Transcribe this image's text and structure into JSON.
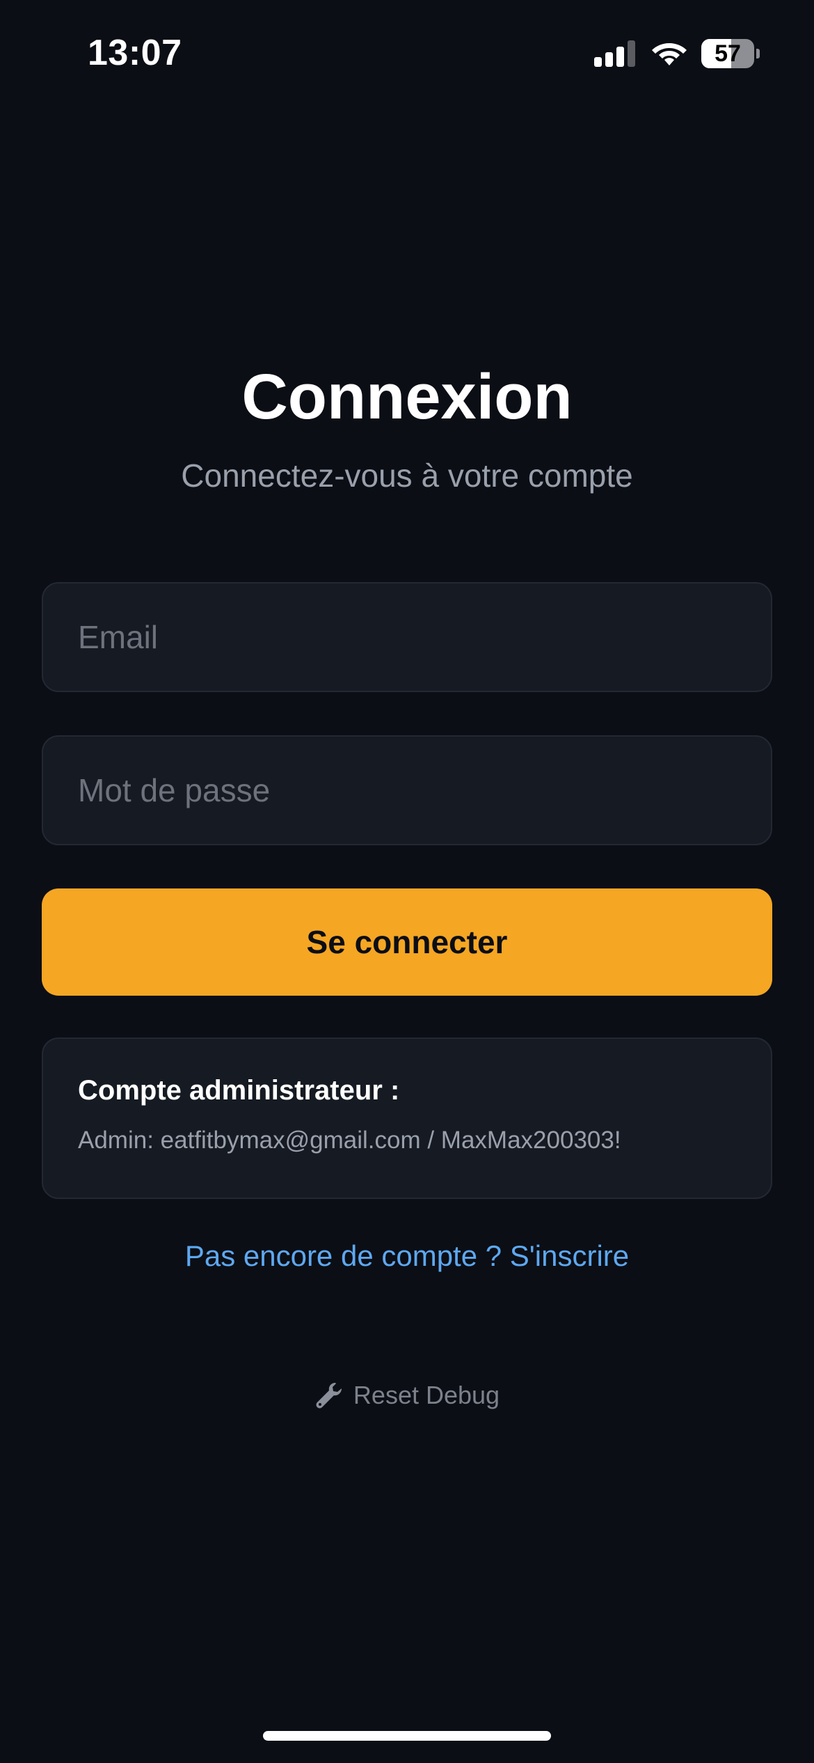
{
  "status_bar": {
    "time": "13:07",
    "battery_level": "57",
    "battery_percent": 57,
    "icons": [
      "signal-icon",
      "wifi-icon",
      "battery-icon"
    ]
  },
  "header": {
    "title": "Connexion",
    "subtitle": "Connectez-vous à votre compte"
  },
  "form": {
    "email_placeholder": "Email",
    "email_value": "",
    "password_placeholder": "Mot de passe",
    "password_value": "",
    "submit_label": "Se connecter"
  },
  "admin_info": {
    "title": "Compte administrateur :",
    "credentials": "Admin: eatfitbymax@gmail.com / MaxMax200303!"
  },
  "signup_link": "Pas encore de compte ? S'inscrire",
  "reset_debug": {
    "icon": "wrench-icon",
    "label": "Reset Debug"
  },
  "colors": {
    "background": "#0b0e15",
    "surface": "#161a22",
    "accent": "#f5a623",
    "link": "#5ea8f0",
    "muted_text": "#9aa0ab"
  }
}
